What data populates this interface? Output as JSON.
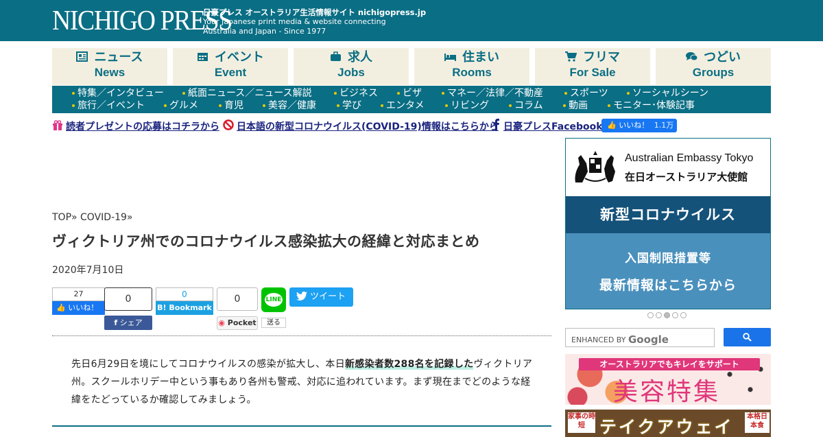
{
  "header": {
    "logo": "NICHIGO PRESS",
    "tagline1": "日豪プレス オーストラリア生活情報サイト nichigopress.jp",
    "tagline2": "Your Japanese print media & website connecting",
    "tagline3": "Australia and Japan - Since 1977"
  },
  "main_nav": [
    {
      "jp": "ニュース",
      "en": "News",
      "icon": "newspaper-icon"
    },
    {
      "jp": "イベント",
      "en": "Event",
      "icon": "calendar-icon"
    },
    {
      "jp": "求人",
      "en": "Jobs",
      "icon": "briefcase-icon"
    },
    {
      "jp": "住まい",
      "en": "Rooms",
      "icon": "bed-icon"
    },
    {
      "jp": "フリマ",
      "en": "For Sale",
      "icon": "cart-icon"
    },
    {
      "jp": "つどい",
      "en": "Groups",
      "icon": "chat-icon"
    }
  ],
  "sub_nav": {
    "row1": [
      "特集／インタビュー",
      "紙面ニュース／ニュース解説",
      "ビジネス",
      "ビザ",
      "マネー／法律／不動産",
      "スポーツ",
      "ソーシャルシーン"
    ],
    "row2": [
      "旅行／イベント",
      "グルメ",
      "育児",
      "美容／健康",
      "学び",
      "エンタメ",
      "リビング",
      "コラム",
      "動画",
      "モニター･体験記事"
    ]
  },
  "notice": {
    "present": "読者プレゼントの応募はコチラから",
    "covid": "日本語の新型コロナウイルス(COVID-19)情報はこちらから",
    "facebook": "日豪プレスFacebook",
    "like_label": "いいね！",
    "like_count": "1.1万"
  },
  "article": {
    "breadcrumb": "TOP» COVID-19»",
    "title": "ヴィクトリア州でのコロナウイルス感染拡大の経緯と対応まとめ",
    "date": "2020年7月10日",
    "body_1": "先日6月29日を境にしてコロナウイルスの感染が拡大し、本日",
    "body_bold": "新感染者数288名を記録した",
    "body_2": "ヴィクトリア州。スクールホリデー中という事もあり各州も警戒、対応に追われています。まず現在までどのような経緯をたどっているか確認してみましょう。"
  },
  "share": {
    "fb_like_count": "27",
    "fb_like_label": "いいね！",
    "fb_share_count": "0",
    "fb_share_label": "シェア",
    "hatena_count": "0",
    "hatena_label": "B! Bookmark",
    "pocket_count": "0",
    "pocket_label": "Pocket",
    "line_label": "LINE",
    "line_send": "送る",
    "tweet_label": "ツイート"
  },
  "sidebar": {
    "embassy_en": "Australian Embassy Tokyo",
    "embassy_jp": "在日オーストラリア大使館",
    "embassy_mid": "新型コロナウイルス",
    "embassy_l1": "入国制限措置等",
    "embassy_l2": "最新情報はこちらから",
    "carousel_active": 3,
    "search_label": "ENHANCED BY",
    "search_brand": "Google",
    "banner1_top": "オーストラリアでもキレイをサポート",
    "banner1_main": "美容特集",
    "banner2_left": "家事の時短",
    "banner2_main": "テイクアウェイ",
    "banner2_right": "本格日本食"
  },
  "colors": {
    "brand": "#0a6e84",
    "nav_bg": "#f3efe0",
    "notice_link": "#1a237e"
  }
}
